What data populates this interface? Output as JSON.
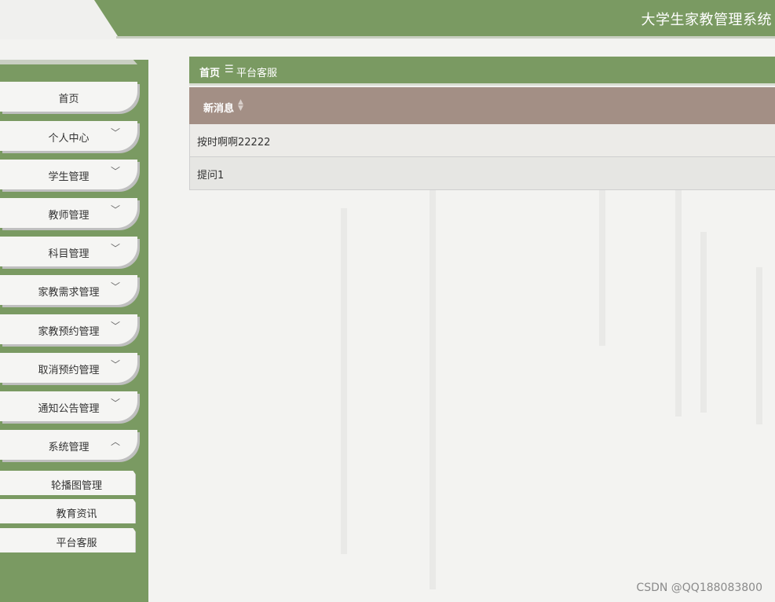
{
  "header": {
    "app_title": "大学生家教管理系统"
  },
  "sidebar": {
    "items": [
      {
        "label": "首页",
        "chevron": ""
      },
      {
        "label": "个人中心",
        "chevron": "﹀"
      },
      {
        "label": "学生管理",
        "chevron": "﹀"
      },
      {
        "label": "教师管理",
        "chevron": "﹀"
      },
      {
        "label": "科目管理",
        "chevron": "﹀"
      },
      {
        "label": "家教需求管理",
        "chevron": "﹀"
      },
      {
        "label": "家教预约管理",
        "chevron": "﹀"
      },
      {
        "label": "取消预约管理",
        "chevron": "﹀"
      },
      {
        "label": "通知公告管理",
        "chevron": "﹀"
      },
      {
        "label": "系统管理",
        "chevron": "︿"
      }
    ],
    "submenu": [
      {
        "label": "轮播图管理"
      },
      {
        "label": "教育资讯"
      },
      {
        "label": "平台客服"
      }
    ]
  },
  "breadcrumb": {
    "home": "首页",
    "separator": "☰",
    "current": "平台客服"
  },
  "table": {
    "header": "新消息",
    "sort_icon": "sort-icon",
    "rows": [
      {
        "message": "按时啊啊22222"
      },
      {
        "message": "提问1"
      }
    ]
  },
  "watermark": "CSDN @QQ188083800",
  "colors": {
    "primary_green": "#7a9a62",
    "table_header": "#a38f85",
    "background": "#f3f3f1"
  }
}
